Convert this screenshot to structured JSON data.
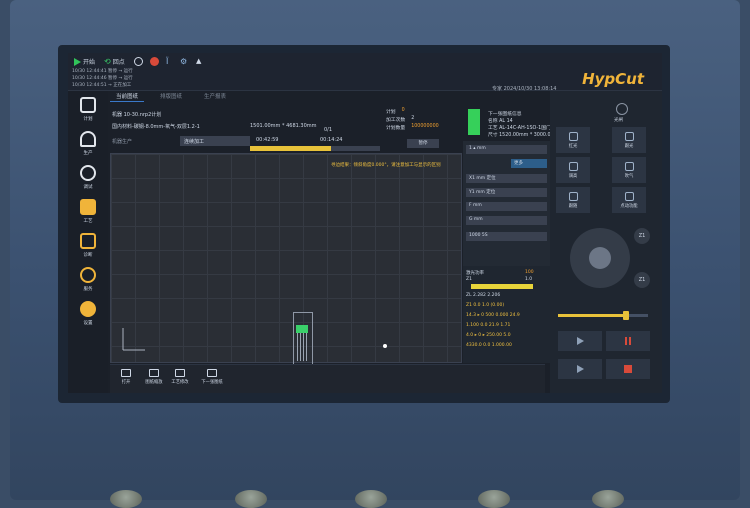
{
  "topbar": {
    "start_label": "开始",
    "return_label": "回点",
    "logs": [
      "10/30 12:44:41 暂停 → 运行",
      "10/30 12:44:46 暂停 → 运行",
      "10/30 12:44:51 → 正在加工"
    ],
    "datetime": "专家    2024/10/30  13:08:14",
    "brand": "HypCut"
  },
  "sidebar": {
    "items": [
      {
        "label": "计划"
      },
      {
        "label": "生产"
      },
      {
        "label": "调试"
      },
      {
        "label": "工艺"
      },
      {
        "label": "诊断"
      },
      {
        "label": "服务"
      },
      {
        "label": "设置"
      }
    ]
  },
  "tabs": [
    "当前图纸",
    "排版图纸",
    "生产报表"
  ],
  "job": {
    "filename": "机器 10-30.nrp2计划",
    "material": "国内材料-碳钢-8.0mm-氧气-双层1.2-1",
    "sheet_size": "1501.00mm * 4681.30mm",
    "count": "0/1",
    "dropdown_left": "机器生产",
    "dropdown_right": "连续加工",
    "elapsed": "00:42:59",
    "remaining": "00:14:24",
    "progress": 0.62
  },
  "counts": {
    "plan_label": "计划",
    "plan_value": "0",
    "processed_label": "加工次数",
    "processed_value": "2",
    "plan_qty_label": "计划数量",
    "plan_qty_value": "100000000",
    "pause_label": "暂停"
  },
  "next_job": {
    "title": "下一张图纸信息",
    "lines": [
      "名称 AL 14",
      "工艺 AL-14C-AH-1SO-1国门",
      "尺寸 1520.00mm * 3000.00mm"
    ]
  },
  "canvas": {
    "hint": "寻边结果：倾斜角度0.000°，请注意加工与显示的区别"
  },
  "bottombar": [
    {
      "label": "打开"
    },
    {
      "label": "图纸缩放"
    },
    {
      "label": "工艺修改"
    },
    {
      "label": "下一张图纸"
    }
  ],
  "midpanel": {
    "rows": [
      "1     ▴    mm",
      "更多",
      "X1        mm   定位",
      "Y1        mm   定位",
      "F        mm",
      "      G        mm",
      "1000        5S"
    ]
  },
  "laser": {
    "label": "激光功率",
    "value": "100",
    "z_label": "Z1",
    "z_value": "1.0",
    "rows": [
      "ZL 2.282   2.206",
      "Z1  0.0   1.0  (0.00)",
      "14.3 ▸ 0   500    0.000    24.9",
      "1.100   0.0   21.9  1.71",
      "4.0 ▸ 0  ▸ 250.00  5.0",
      "4330.0  0.0  1.000.00"
    ]
  },
  "rpanel": {
    "top_label": "光闸",
    "buttons": [
      "红光",
      "跟光",
      "调高",
      "吹气",
      "跟随",
      "点动功能"
    ],
    "z_buttons": [
      "Z1",
      "Z1"
    ]
  },
  "colors": {
    "accent": "#3a78c8",
    "progress": "#e8c23a",
    "status_green": "#36d05a",
    "brand": "#f0b43a"
  }
}
